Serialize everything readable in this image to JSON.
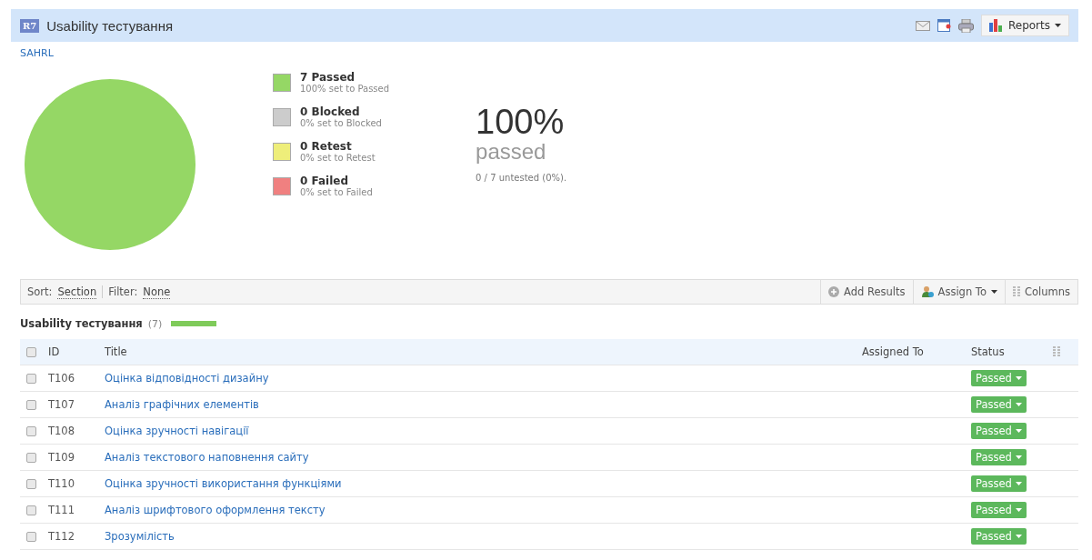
{
  "header": {
    "badge": "R7",
    "title": "Usability тестування",
    "reports_button": "Reports"
  },
  "project_link": "SAHRL",
  "summary": {
    "chart_data": {
      "type": "pie",
      "categories": [
        "Passed",
        "Blocked",
        "Retest",
        "Failed"
      ],
      "values": [
        100,
        0,
        0,
        0
      ]
    },
    "legend": [
      {
        "count": "7",
        "subtitle": "100% set to Passed",
        "color": "#95d765"
      },
      {
        "count": "0",
        "subtitle": "0% set to Blocked",
        "color": "#cccccc"
      },
      {
        "count": "0",
        "subtitle": "0% set to Retest",
        "color": "#eeee7a"
      },
      {
        "count": "0",
        "subtitle": "0% set to Failed",
        "color": "#f08080"
      }
    ],
    "percent": "100%",
    "percent_label": "passed",
    "untested": "0 / 7 untested (0%)."
  },
  "toolbar": {
    "sort_label": "Sort:",
    "sort_value": "Section",
    "filter_label": "Filter:",
    "filter_value": "None",
    "actions": [
      "Add Results",
      "Assign To",
      "Columns"
    ]
  },
  "section": {
    "title": "Usability тестування",
    "count": "(7)",
    "level": 1
  },
  "table": {
    "select_all_checked": false,
    "columns": [
      "ID",
      "Title",
      "Assigned To",
      "Status"
    ],
    "rows": [
      {
        "id": "T106",
        "title": "Оцінка відповідності дизайну",
        "status": "Passed",
        "checked": false
      },
      {
        "id": "T107",
        "title": "Аналіз графічних елементів",
        "status": "Passed",
        "checked": false
      },
      {
        "id": "T108",
        "title": "Оцінка зручності навігації",
        "status": "Passed",
        "checked": false
      },
      {
        "id": "T109",
        "title": "Аналіз текстового наповнення сайту",
        "status": "Passed",
        "checked": false
      },
      {
        "id": "T110",
        "title": "Оцінка зручності використання функціями",
        "status": "Passed",
        "checked": false
      },
      {
        "id": "T111",
        "title": "Аналіз шрифтового оформлення тексту",
        "status": "Passed",
        "checked": false
      },
      {
        "id": "T112",
        "title": "Зрозумілість",
        "status": "Passed",
        "checked": false
      }
    ]
  }
}
